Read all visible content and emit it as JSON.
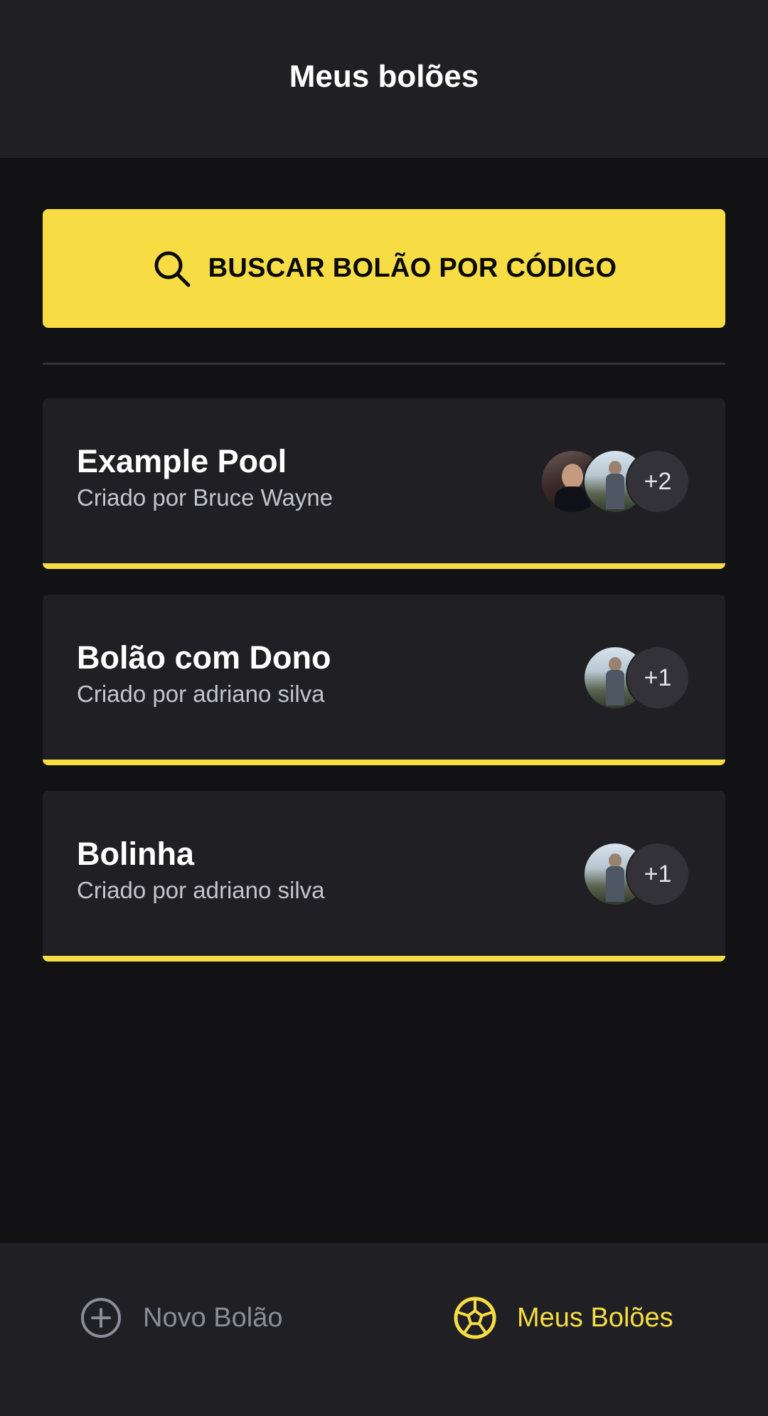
{
  "header": {
    "title": "Meus bolões"
  },
  "search_button": {
    "label": "BUSCAR BOLÃO POR CÓDIGO",
    "icon": "search-icon"
  },
  "pools": [
    {
      "title": "Example Pool",
      "owner": "Criado por Bruce Wayne",
      "avatars": [
        "avatar-suit-man",
        "avatar-outdoor-man"
      ],
      "extra_count": "+2"
    },
    {
      "title": "Bolão com Dono",
      "owner": "Criado por adriano silva",
      "avatars": [
        "avatar-outdoor-man"
      ],
      "extra_count": "+1"
    },
    {
      "title": "Bolinha",
      "owner": "Criado por adriano silva",
      "avatars": [
        "avatar-outdoor-man"
      ],
      "extra_count": "+1"
    }
  ],
  "bottom_nav": {
    "new_pool": {
      "label": "Novo Bolão",
      "icon": "plus-circle-icon",
      "active": false
    },
    "my_pools": {
      "label": "Meus Bolões",
      "icon": "soccer-ball-icon",
      "active": true
    }
  },
  "colors": {
    "background": "#121214",
    "surface": "#202024",
    "accent": "#f7dd43",
    "muted": "#8d8d99"
  }
}
